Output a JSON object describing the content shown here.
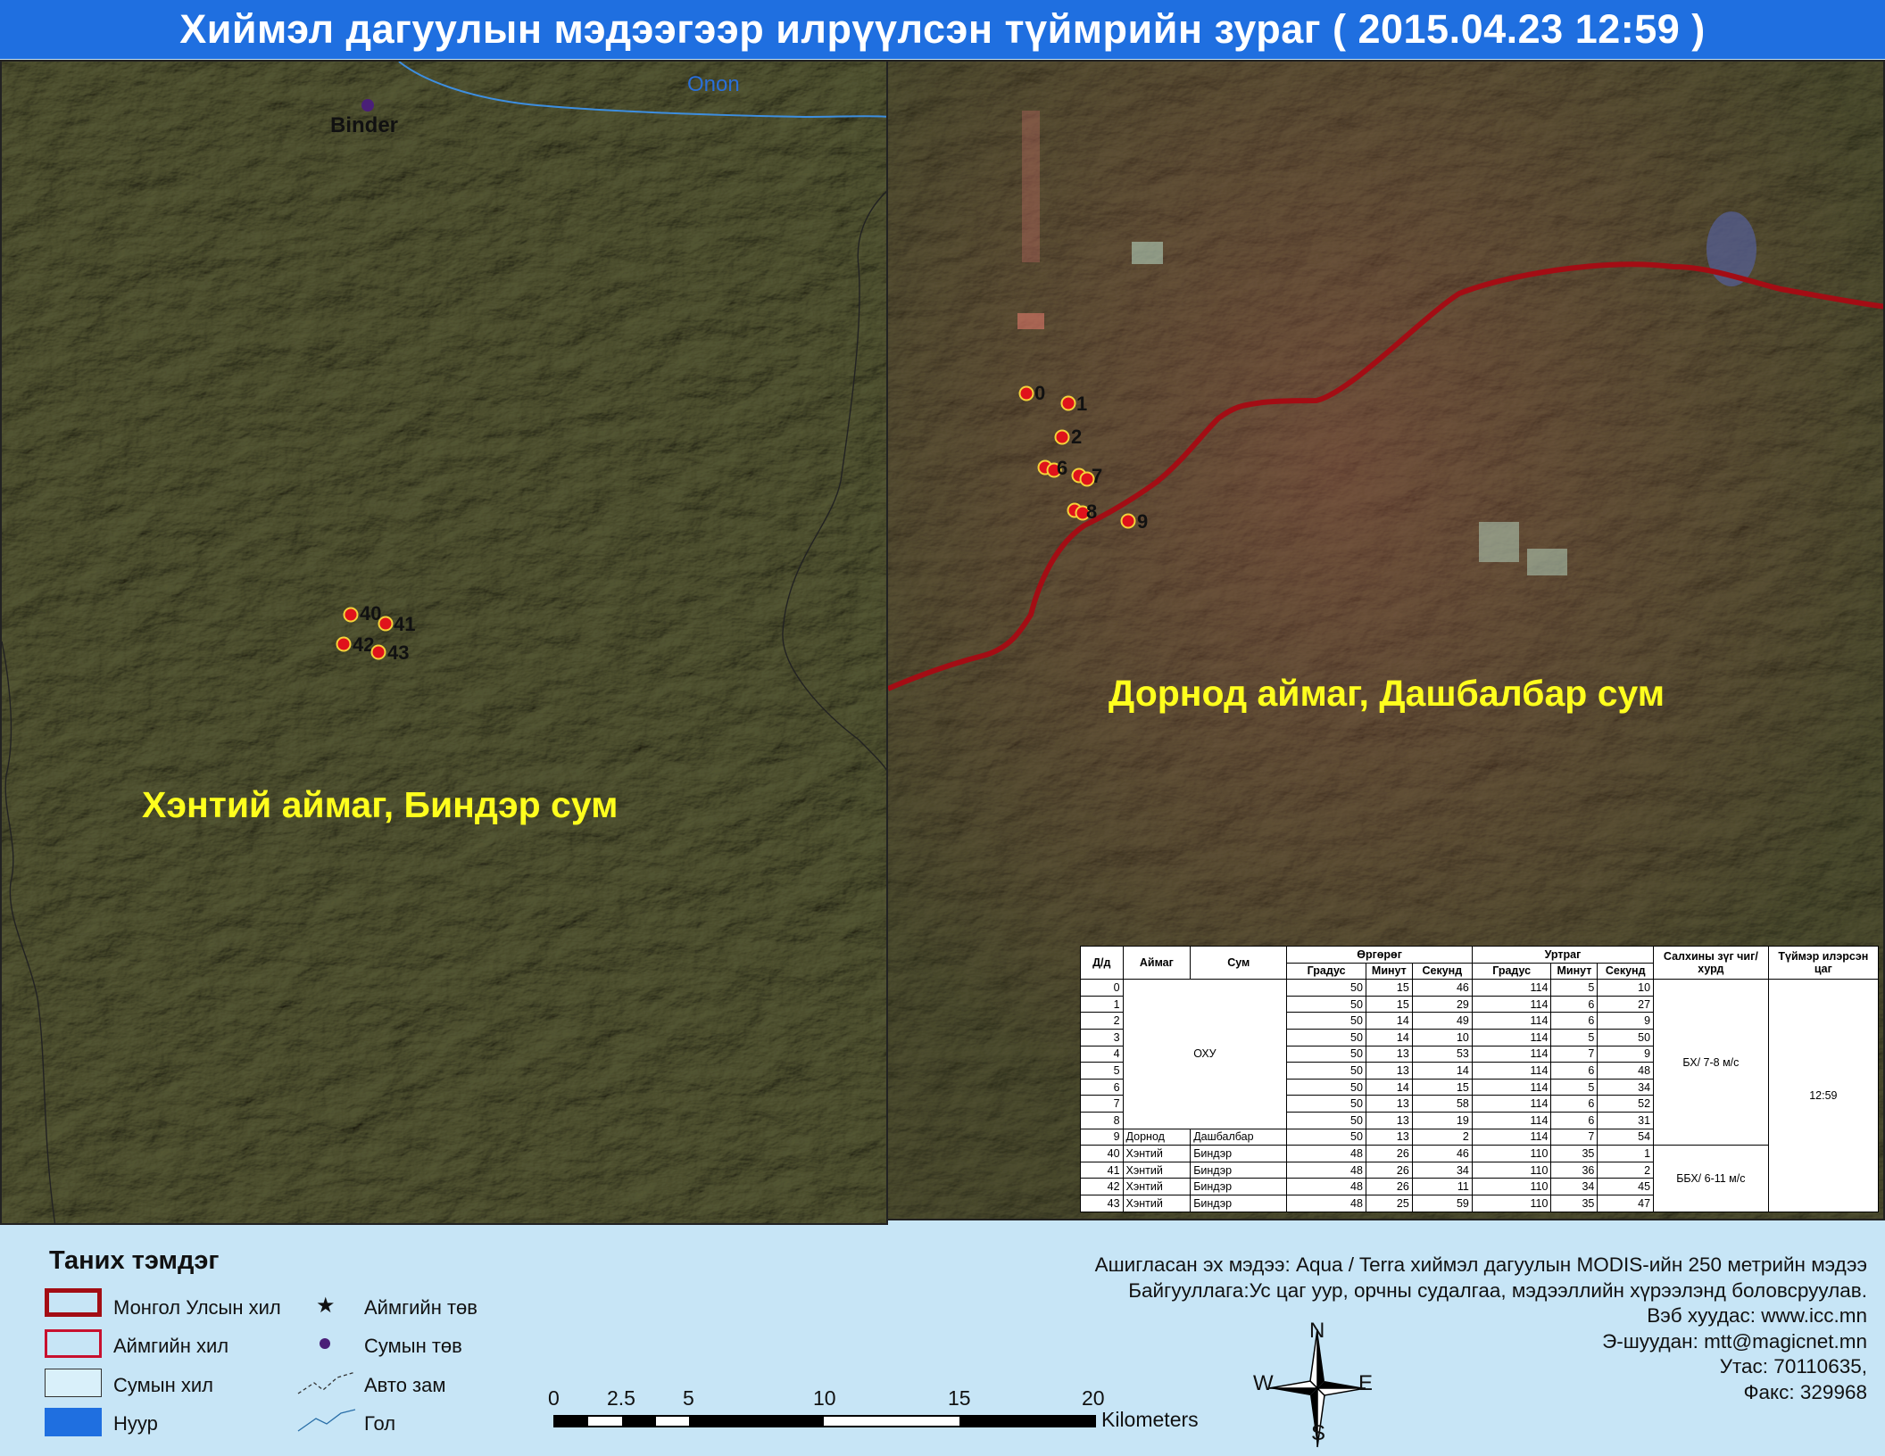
{
  "title": "Хиймэл дагуулын мэдээгээр илрүүлсэн түймрийн зураг  ( 2015.04.23  12:59 )",
  "left_map": {
    "region_label": "Хэнтий аймаг, Биндэр сум",
    "place_label": "Binder",
    "river_label": "Onon",
    "fires": [
      {
        "id": "40",
        "label": "40"
      },
      {
        "id": "41",
        "label": "41"
      },
      {
        "id": "42",
        "label": "42"
      },
      {
        "id": "43",
        "label": "43"
      }
    ]
  },
  "right_map": {
    "region_label": "Дорнод аймаг, Дашбалбар сум",
    "fires": [
      {
        "id": "0",
        "label": "0"
      },
      {
        "id": "1",
        "label": "1"
      },
      {
        "id": "2",
        "label": "2"
      },
      {
        "id": "6",
        "label": "6"
      },
      {
        "id": "7",
        "label": "7"
      },
      {
        "id": "8",
        "label": "8"
      },
      {
        "id": "9",
        "label": "9"
      }
    ]
  },
  "table": {
    "headers": {
      "dd": "Д/д",
      "aimag": "Аймаг",
      "sum": "Сум",
      "lat": "Өргөрөг",
      "lon": "Уртраг",
      "deg": "Градус",
      "min": "Минут",
      "sec": "Секунд",
      "wind": "Салхины зүг чиг/хурд",
      "time": "Түймэр илэрсэн цаг"
    },
    "ohu_label": "ОХУ",
    "wind_1": "БХ/ 7-8 м/с",
    "wind_2": "ББХ/ 6-11 м/с",
    "detected_time": "12:59",
    "rows": [
      {
        "dd": "0",
        "aimag": "",
        "sum": "",
        "lat": [
          "50",
          "15",
          "46"
        ],
        "lon": [
          "114",
          "5",
          "10"
        ]
      },
      {
        "dd": "1",
        "aimag": "",
        "sum": "",
        "lat": [
          "50",
          "15",
          "29"
        ],
        "lon": [
          "114",
          "6",
          "27"
        ]
      },
      {
        "dd": "2",
        "aimag": "",
        "sum": "",
        "lat": [
          "50",
          "14",
          "49"
        ],
        "lon": [
          "114",
          "6",
          "9"
        ]
      },
      {
        "dd": "3",
        "aimag": "",
        "sum": "",
        "lat": [
          "50",
          "14",
          "10"
        ],
        "lon": [
          "114",
          "5",
          "50"
        ]
      },
      {
        "dd": "4",
        "aimag": "",
        "sum": "",
        "lat": [
          "50",
          "13",
          "53"
        ],
        "lon": [
          "114",
          "7",
          "9"
        ]
      },
      {
        "dd": "5",
        "aimag": "",
        "sum": "",
        "lat": [
          "50",
          "13",
          "14"
        ],
        "lon": [
          "114",
          "6",
          "48"
        ]
      },
      {
        "dd": "6",
        "aimag": "",
        "sum": "",
        "lat": [
          "50",
          "14",
          "15"
        ],
        "lon": [
          "114",
          "5",
          "34"
        ]
      },
      {
        "dd": "7",
        "aimag": "",
        "sum": "",
        "lat": [
          "50",
          "13",
          "58"
        ],
        "lon": [
          "114",
          "6",
          "52"
        ]
      },
      {
        "dd": "8",
        "aimag": "",
        "sum": "",
        "lat": [
          "50",
          "13",
          "19"
        ],
        "lon": [
          "114",
          "6",
          "31"
        ]
      },
      {
        "dd": "9",
        "aimag": "Дорнод",
        "sum": "Дашбалбар",
        "lat": [
          "50",
          "13",
          "2"
        ],
        "lon": [
          "114",
          "7",
          "54"
        ]
      },
      {
        "dd": "40",
        "aimag": "Хэнтий",
        "sum": "Биндэр",
        "lat": [
          "48",
          "26",
          "46"
        ],
        "lon": [
          "110",
          "35",
          "1"
        ]
      },
      {
        "dd": "41",
        "aimag": "Хэнтий",
        "sum": "Биндэр",
        "lat": [
          "48",
          "26",
          "34"
        ],
        "lon": [
          "110",
          "36",
          "2"
        ]
      },
      {
        "dd": "42",
        "aimag": "Хэнтий",
        "sum": "Биндэр",
        "lat": [
          "48",
          "26",
          "11"
        ],
        "lon": [
          "110",
          "34",
          "45"
        ]
      },
      {
        "dd": "43",
        "aimag": "Хэнтий",
        "sum": "Биндэр",
        "lat": [
          "48",
          "25",
          "59"
        ],
        "lon": [
          "110",
          "35",
          "47"
        ]
      }
    ]
  },
  "legend": {
    "title": "Таних тэмдэг",
    "items": [
      {
        "label": "Монгол Улсын хил",
        "icon": "national-border"
      },
      {
        "label": "Аймгийн хил",
        "icon": "province-border"
      },
      {
        "label": "Сумын хил",
        "icon": "soum-border"
      },
      {
        "label": "Нуур",
        "icon": "lake"
      },
      {
        "label": "Аймгийн төв",
        "icon": "star-icon"
      },
      {
        "label": "Сумын төв",
        "icon": "dot-icon"
      },
      {
        "label": "Авто зам",
        "icon": "road-line"
      },
      {
        "label": "Гол",
        "icon": "river-line"
      }
    ]
  },
  "scale": {
    "ticks": [
      "0",
      "2.5",
      "5",
      "10",
      "15",
      "20"
    ],
    "unit": "Kilometers"
  },
  "compass": {
    "n": "N",
    "s": "S",
    "e": "E",
    "w": "W"
  },
  "credits": [
    "Ашигласан эх мэдээ: Aqua / Terra хиймэл дагуулын MODIS-ийн 250 метрийн мэдээ",
    "Байгууллага:Ус цаг уур, орчны судалгаа, мэдээллийн хүрээлэнд боловсруулав.",
    "Вэб хуудас: www.icc.mn",
    "Э-шуудан: mtt@magicnet.mn",
    "Утас: 70110635,",
    "Факс: 329968"
  ],
  "colors": {
    "title_bg": "#1f6fe0",
    "legend_bg": "#c7e5f6",
    "national_border": "#a30d14",
    "province_border": "#c8102e",
    "fire": "#e0121b",
    "region_label": "#ffff1e"
  }
}
